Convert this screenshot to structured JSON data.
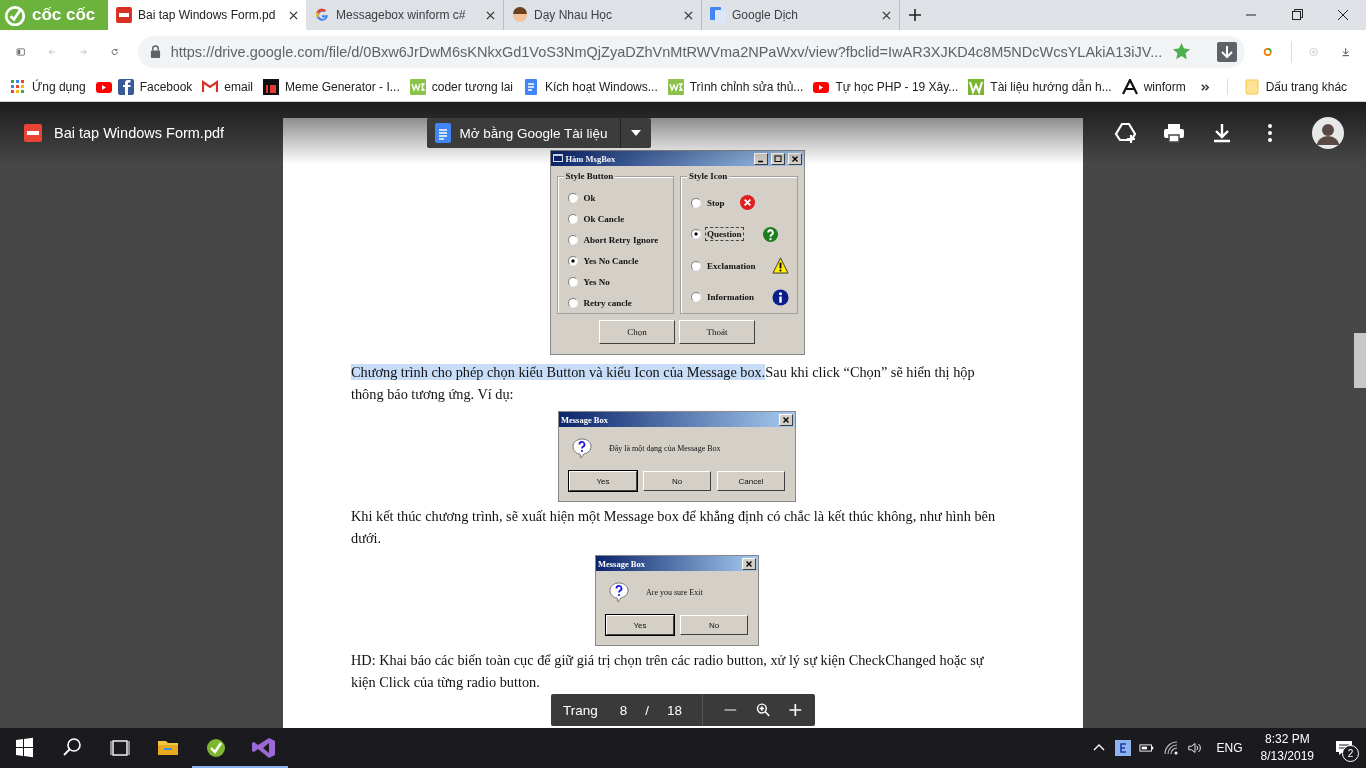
{
  "brand": "cốc cốc",
  "tabs": [
    {
      "title": "Bai tap Windows Form.pd",
      "selected": true
    },
    {
      "title": "Messagebox winform c#",
      "selected": false
    },
    {
      "title": "Dạy Nhau Học",
      "selected": false
    },
    {
      "title": "Google Dịch",
      "selected": false
    }
  ],
  "url": "https://drive.google.com/file/d/0Bxw6JrDwM6sKNkxGd1VoS3NmQjZyaDZhVnMtRWVma2NPaWxv/view?fbclid=IwAR3XJKD4c8M5NDcWcsYLAkiA13iJV...",
  "bookmarks": [
    {
      "label": "Ứng dụng"
    },
    {
      "label": "Facebook"
    },
    {
      "label": "email"
    },
    {
      "label": "Meme Generator - I..."
    },
    {
      "label": "coder tương lai"
    },
    {
      "label": "Kích hoạt Windows..."
    },
    {
      "label": "Trình chỉnh sửa thủ..."
    },
    {
      "label": "Tự học PHP - 19 Xây..."
    },
    {
      "label": "Tài liệu hướng dẫn h..."
    },
    {
      "label": "winform"
    }
  ],
  "other_bookmarks": "Dấu trang khác",
  "viewer": {
    "file_name": "Bai tap Windows Form.pdf",
    "open_with": "Mở bằng Google Tài liệu"
  },
  "blocks": [
    {
      "kind": "form",
      "title": "Hàm MsgBox",
      "groups": [
        {
          "title": "Style Button",
          "options": [
            {
              "label": "Ok",
              "selected": false,
              "focused": false
            },
            {
              "label": "Ok Cancle",
              "selected": false,
              "focused": false
            },
            {
              "label": "Abort Retry Ignore",
              "selected": false,
              "focused": false
            },
            {
              "label": "Yes No Cancle",
              "selected": true,
              "focused": false
            },
            {
              "label": "Yes No",
              "selected": false,
              "focused": false
            },
            {
              "label": "Retry cancle",
              "selected": false,
              "focused": false
            }
          ]
        },
        {
          "title": "Style Icon",
          "options": [
            {
              "label": "Stop",
              "selected": false,
              "focused": false
            },
            {
              "label": "Question",
              "selected": true,
              "focused": true
            },
            {
              "label": "Exclamation",
              "selected": false,
              "focused": false
            },
            {
              "label": "Information",
              "selected": false,
              "focused": false
            }
          ]
        }
      ],
      "buttons": [
        "Chọn",
        "Thoát"
      ]
    },
    {
      "kind": "paragraph",
      "highlight": "Chương trình cho phép chọn kiểu Button và kiểu Icon của Message box.",
      "text": "Sau khi click “Chọn” sẽ hiển thị hộp thông báo tương ứng. Ví dụ:"
    },
    {
      "kind": "msgbox",
      "title": "Message Box",
      "message": "Đây là một dạng của Message Box",
      "buttons": [
        {
          "label": "Yes",
          "default": true
        },
        {
          "label": "No",
          "default": false
        },
        {
          "label": "Cancel",
          "default": false
        }
      ]
    },
    {
      "kind": "paragraph",
      "text": "Khi kết thúc chương trình, sẽ xuất hiện một Message box để khẳng định có chắc là kết thúc không, như hình bên dưới."
    },
    {
      "kind": "msgbox",
      "title": "Message Box",
      "message": "Are you sure Exit",
      "buttons": [
        {
          "label": "Yes",
          "default": true
        },
        {
          "label": "No",
          "default": false
        }
      ]
    },
    {
      "kind": "paragraph",
      "text": "HD: Khai báo các biến toàn cục để giữ giá trị chọn trên các radio button, xử lý sự kiện CheckChanged hoặc sự kiện Click của từng radio button."
    }
  ],
  "pager": {
    "label": "Trang",
    "page": "8",
    "separator": "/",
    "total": "18"
  },
  "taskbar": {
    "language": "ENG",
    "time": "8:32 PM",
    "date": "8/13/2019",
    "notifications": "2"
  }
}
